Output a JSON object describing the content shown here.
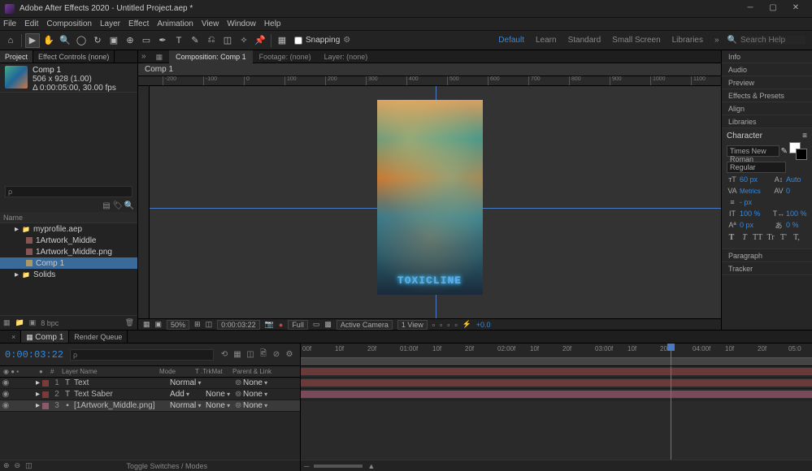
{
  "titlebar": {
    "app": "Adobe After Effects 2020",
    "doc": "Untitled Project.aep *"
  },
  "menu": [
    "File",
    "Edit",
    "Composition",
    "Layer",
    "Effect",
    "Animation",
    "View",
    "Window",
    "Help"
  ],
  "snapping_label": "Snapping",
  "workspaces": {
    "items": [
      "Default",
      "Learn",
      "Standard",
      "Small Screen",
      "Libraries"
    ],
    "active": 0
  },
  "search_placeholder": "Search Help",
  "project": {
    "tabs": {
      "project": "Project",
      "fx": "Effect Controls (none)"
    },
    "selected": {
      "name": "Comp 1",
      "dims": "506 x 928 (1.00)",
      "dur": "Δ 0:00:05:00, 30.00 fps"
    },
    "listhdr": "Name",
    "items": [
      {
        "name": "myprofile.aep",
        "type": "folder",
        "indent": 0
      },
      {
        "name": "1Artwork_Middle",
        "type": "footage",
        "indent": 1
      },
      {
        "name": "1Artwork_Middle.png",
        "type": "footage",
        "indent": 1
      },
      {
        "name": "Comp 1",
        "type": "comp",
        "indent": 1,
        "selected": true
      },
      {
        "name": "Solids",
        "type": "folder",
        "indent": 0
      }
    ],
    "footer_bpc": "8 bpc"
  },
  "viewer": {
    "tabs": {
      "comp": "Composition: Comp 1",
      "footage": "Footage: (none)",
      "layer": "Layer: (none)"
    },
    "comptab": "Comp 1",
    "neon": "TOXICLINE",
    "footer": {
      "zoom": "50%",
      "time": "0:00:03:22",
      "res": "Full",
      "camera": "Active Camera",
      "views": "1 View",
      "exp": "+0.0"
    }
  },
  "rightpanels": [
    "Info",
    "Audio",
    "Preview",
    "Effects & Presets",
    "Align",
    "Libraries"
  ],
  "char": {
    "title": "Character",
    "font": "Times New Roman",
    "style": "Regular",
    "size": "60 px",
    "leading": "Auto",
    "kerning": "Metrics",
    "tracking": "0",
    "stroke": "- px",
    "vscale": "100 %",
    "hscale": "100 %",
    "baseline": "0 px",
    "tsume": "0 %",
    "styles": [
      "T",
      "T",
      "TT",
      "Tr",
      "T'",
      "T,"
    ]
  },
  "panels2": [
    "Paragraph",
    "Tracker"
  ],
  "timeline": {
    "tabs": {
      "comp": "Comp 1",
      "rq": "Render Queue"
    },
    "timecode": "0:00:03:22",
    "cols": {
      "layer": "Layer Name",
      "mode": "Mode",
      "trk": "T .TrkMat",
      "parent": "Parent & Link"
    },
    "layers": [
      {
        "num": "1",
        "type": "T",
        "name": "Text",
        "mode": "Normal",
        "trk": "",
        "parent": "None",
        "color": "#7a3a3a"
      },
      {
        "num": "2",
        "type": "T",
        "name": "Text Saber",
        "mode": "Add",
        "trk": "None",
        "parent": "None",
        "color": "#7a3a3a"
      },
      {
        "num": "3",
        "type": "▪",
        "name": "[1Artwork_Middle.png]",
        "mode": "Normal",
        "trk": "None",
        "parent": "None",
        "color": "#8a5a6a",
        "selected": true
      }
    ],
    "switches": "Toggle Switches / Modes",
    "ruler": [
      "00f",
      "10f",
      "20f",
      "01:00f",
      "10f",
      "20f",
      "02:00f",
      "10f",
      "20f",
      "03:00f",
      "10f",
      "20f",
      "04:00f",
      "10f",
      "20f",
      "05:0"
    ]
  }
}
